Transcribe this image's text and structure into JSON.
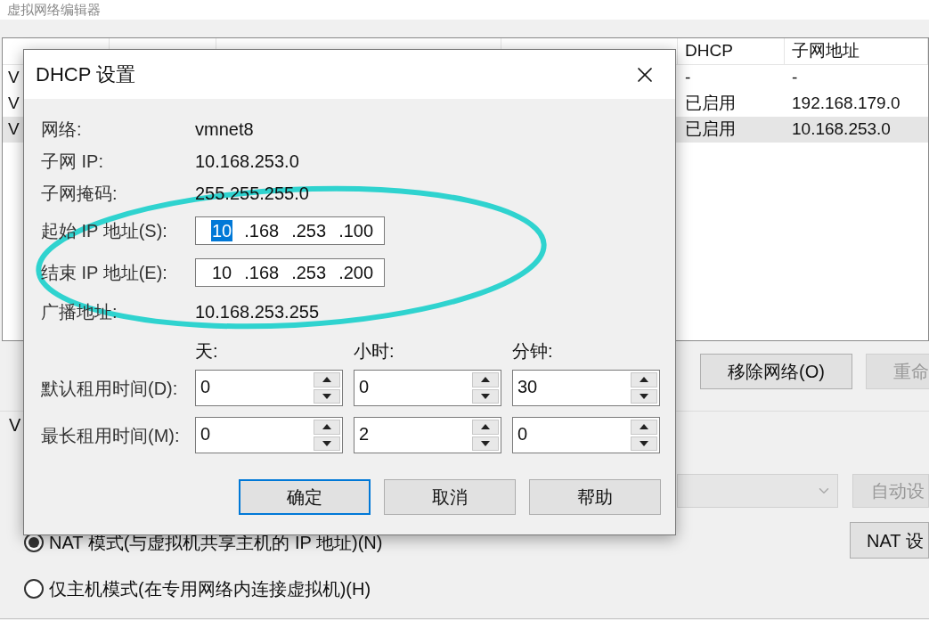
{
  "window": {
    "title": "虚拟网络编辑器"
  },
  "network_table": {
    "columns": [
      "DHCP",
      "子网地址"
    ],
    "rows": [
      {
        "name": "V",
        "dhcp": "-",
        "subnet": "-",
        "selected": false
      },
      {
        "name": "V",
        "dhcp": "已启用",
        "subnet": "192.168.179.0",
        "selected": false
      },
      {
        "name": "V",
        "dhcp": "已启用",
        "subnet": "10.168.253.0",
        "selected": true
      }
    ]
  },
  "buttons": [
    {
      "label": "移除网络(O)",
      "disabled": false
    },
    {
      "label": "重命",
      "disabled": true
    }
  ],
  "section_label": "V",
  "auto_button": {
    "label": "自动设",
    "disabled": true
  },
  "nat_button": {
    "label": "NAT 设"
  },
  "modes": [
    {
      "label": "NAT 模式(与虚拟机共享主机的 IP 地址)(N)",
      "selected": true
    },
    {
      "label": "仅主机模式(在专用网络内连接虚拟机)(H)",
      "selected": false
    }
  ],
  "dialog": {
    "title": "DHCP 设置",
    "info_top": [
      {
        "label": "网络:",
        "value": "vmnet8"
      },
      {
        "label": "子网 IP:",
        "value": "10.168.253.0"
      },
      {
        "label": "子网掩码:",
        "value": "255.255.255.0"
      }
    ],
    "ip_fields": [
      {
        "label": "起始 IP 地址(S):",
        "octets": [
          {
            "text": "10",
            "selected": true
          },
          {
            "text": ".168",
            "selected": false
          },
          {
            "text": ".253",
            "selected": false
          },
          {
            "text": ".100",
            "selected": false
          }
        ]
      },
      {
        "label": "结束 IP 地址(E):",
        "octets": [
          {
            "text": "10",
            "selected": false
          },
          {
            "text": ".168",
            "selected": false
          },
          {
            "text": ".253",
            "selected": false
          },
          {
            "text": ".200",
            "selected": false
          }
        ]
      }
    ],
    "info_bottom": [
      {
        "label": "广播地址:",
        "value": "10.168.253.255"
      }
    ],
    "lease_columns": [
      "天:",
      "小时:",
      "分钟:"
    ],
    "lease_rows": [
      {
        "label": "默认租用时间(D):",
        "values": [
          "0",
          "0",
          "30"
        ]
      },
      {
        "label": "最长租用时间(M):",
        "values": [
          "0",
          "2",
          "0"
        ]
      }
    ],
    "buttons": [
      {
        "label": "确定",
        "default": true
      },
      {
        "label": "取消",
        "default": false
      },
      {
        "label": "帮助",
        "default": false
      }
    ]
  },
  "annotation": {
    "kind": "ellipse"
  }
}
